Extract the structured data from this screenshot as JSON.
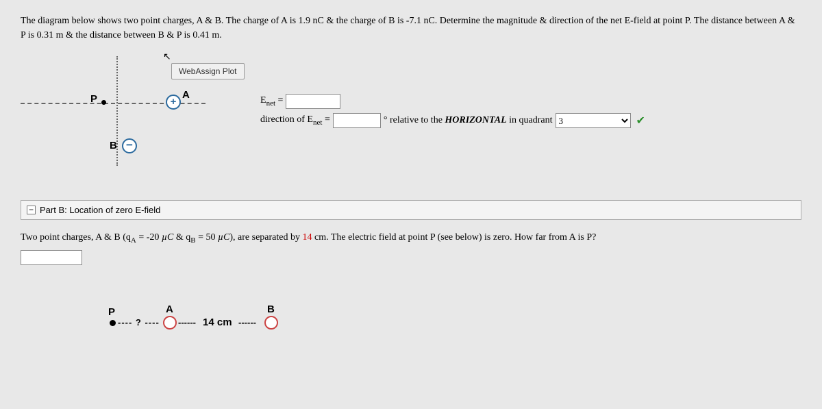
{
  "intro": "The diagram below shows two point charges, A & B. The charge of A is 1.9 nC & the charge of B is -7.1 nC. Determine the magnitude & direction of the net E-field at point P. The distance between A & P is 0.31 m & the distance between B & P is 0.41 m.",
  "diagram_a": {
    "labels": {
      "P": "P",
      "A": "A",
      "B": "B"
    },
    "signA": "+",
    "signB": "−",
    "webassign_btn": "WebAssign Plot",
    "cursor": "↖"
  },
  "answers_a": {
    "Enet_label_pre": "E",
    "Enet_label_sub": "net",
    "eq": " = ",
    "dir_pre": "direction of E",
    "dir_sub": "net",
    "deg": "° relative to the ",
    "horizontal": "HORIZONTAL",
    "in_quad": " in quadrant ",
    "selected_quadrant": "3",
    "check": "✔"
  },
  "part_b": {
    "header_icon": "−",
    "header_title": "Part B: Location of zero E-field",
    "body_pre": "Two point charges, A & B (q",
    "subA": "A",
    "qA_val": " = -20 ",
    "muC": "µC",
    "amp": " & q",
    "subB": "B",
    "qB_val": " = 50 ",
    "body_post": "), are separated by ",
    "sep": "14",
    "cm": " cm. The electric field at point P (see below) is zero. How far from A is P?"
  },
  "diagram_b": {
    "P": "P",
    "A": "A",
    "B": "B",
    "distance": "14 cm"
  }
}
